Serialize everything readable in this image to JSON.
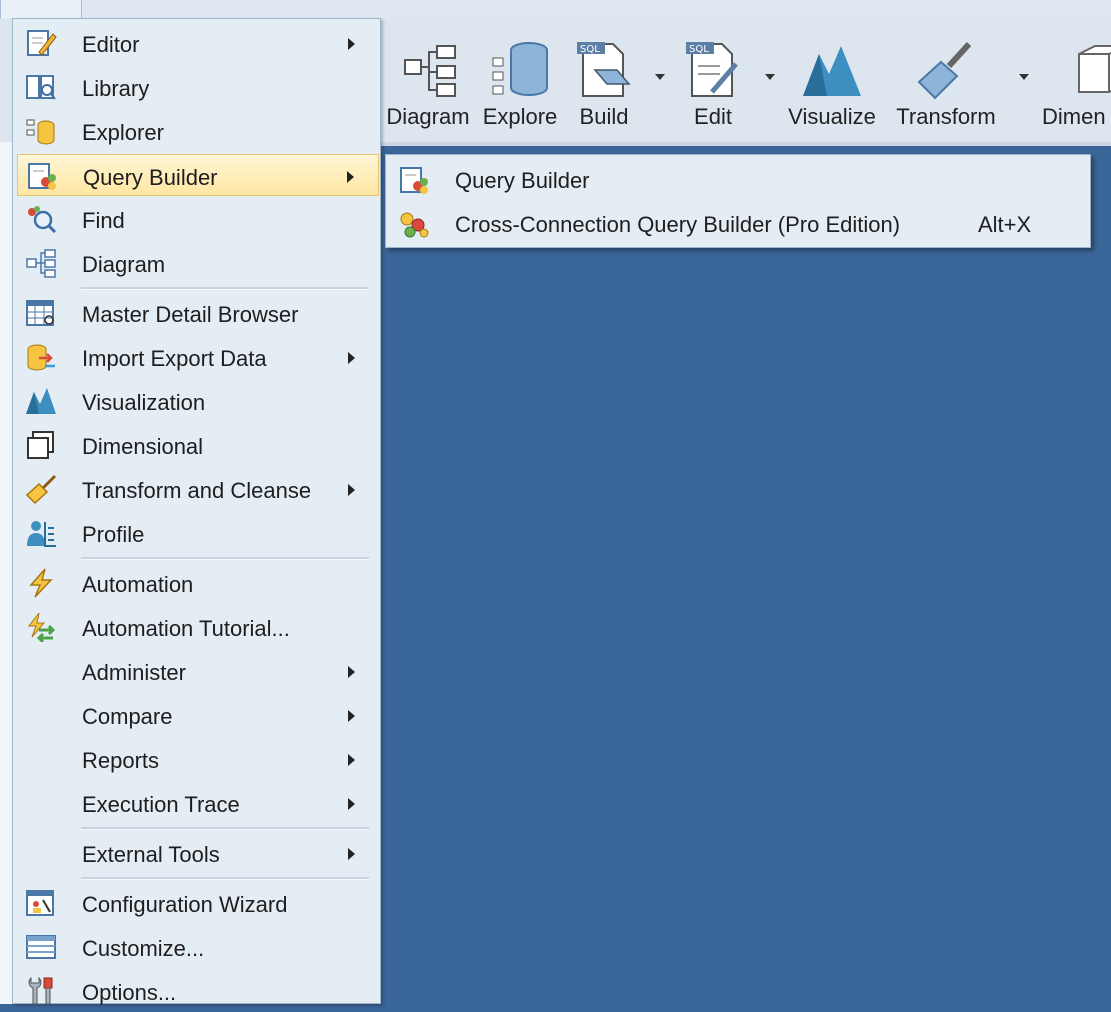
{
  "colors": {
    "workspace": "#3b6699",
    "menu_bg": "#e4ecf4",
    "highlight": "#ffe7a3",
    "border": "#9fb5cc"
  },
  "toolbar": {
    "buttons": [
      {
        "label": "Diagram",
        "icon": "diagram-icon"
      },
      {
        "label": "Explore",
        "icon": "database-icon"
      },
      {
        "label": "Build",
        "icon": "sql-build-icon",
        "dropdown": true
      },
      {
        "label": "Edit",
        "icon": "sql-edit-icon",
        "dropdown": true
      },
      {
        "label": "Visualize",
        "icon": "chart-mountain-icon"
      },
      {
        "label": "Transform",
        "icon": "broom-icon",
        "dropdown": true
      },
      {
        "label": "Dimen",
        "icon": "cube-icon"
      }
    ]
  },
  "tools_menu": {
    "items": [
      {
        "label": "Editor",
        "icon": "editor-icon",
        "submenu": true
      },
      {
        "label": "Library",
        "icon": "library-icon"
      },
      {
        "label": "Explorer",
        "icon": "explorer-icon"
      },
      {
        "label": "Query Builder",
        "icon": "query-builder-icon",
        "submenu": true,
        "active": true
      },
      {
        "label": "Find",
        "icon": "find-icon"
      },
      {
        "label": "Diagram",
        "icon": "diagram-icon"
      },
      {
        "label": "Master Detail Browser",
        "icon": "grid-icon"
      },
      {
        "label": "Import Export Data",
        "icon": "import-export-icon",
        "submenu": true
      },
      {
        "label": "Visualization",
        "icon": "visualization-icon"
      },
      {
        "label": "Dimensional",
        "icon": "dimensional-icon"
      },
      {
        "label": "Transform and Cleanse",
        "icon": "broom-icon",
        "submenu": true
      },
      {
        "label": "Profile",
        "icon": "profile-icon"
      },
      {
        "label": "Automation",
        "icon": "lightning-icon"
      },
      {
        "label": "Automation Tutorial...",
        "icon": "tutorial-icon"
      },
      {
        "label": "Administer",
        "submenu": true
      },
      {
        "label": "Compare",
        "submenu": true
      },
      {
        "label": "Reports",
        "submenu": true
      },
      {
        "label": "Execution Trace",
        "submenu": true
      },
      {
        "label": "External Tools",
        "submenu": true
      },
      {
        "label": "Configuration Wizard",
        "icon": "wizard-icon"
      },
      {
        "label": "Customize...",
        "icon": "customize-icon"
      },
      {
        "label": "Options...",
        "icon": "tools-icon"
      }
    ]
  },
  "query_builder_submenu": {
    "items": [
      {
        "label": "Query Builder",
        "icon": "query-builder-icon",
        "shortcut": ""
      },
      {
        "label": "Cross-Connection Query Builder (Pro Edition)",
        "icon": "cross-connection-icon",
        "shortcut": "Alt+X"
      }
    ]
  }
}
